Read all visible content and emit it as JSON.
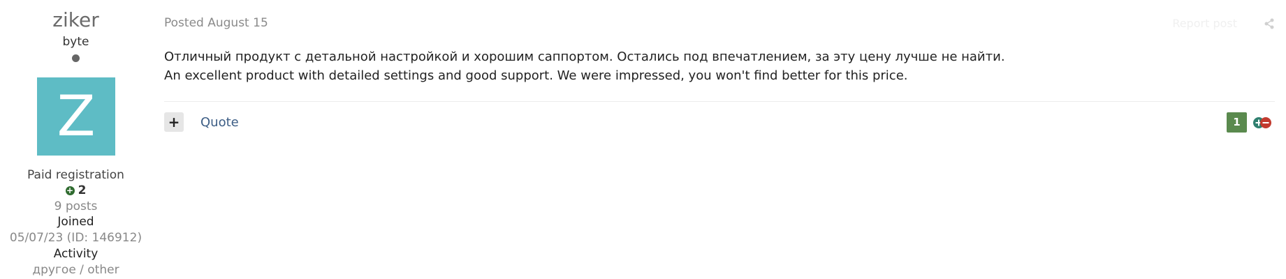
{
  "author": {
    "name": "ziker",
    "rank": "byte",
    "avatar_letter": "Z",
    "avatar_color": "#5ebcc5",
    "group": "Paid registration",
    "reputation": "2",
    "posts": "9 posts",
    "joined_label": "Joined",
    "joined_value": "05/07/23 (ID: 146912)",
    "activity_label": "Activity",
    "activity_value": "другое / other"
  },
  "post": {
    "posted_prefix": "Posted",
    "date": "August 15",
    "report_label": "Report post",
    "content": [
      "Отличный продукт с детальной настройкой и хорошим саппортом. Остались под впечатлением, за эту цену лучше не найти.",
      "An excellent product with detailed settings and good support. We were impressed, you won't find better for this price."
    ],
    "multiquote_icon": "plus-icon",
    "quote_label": "Quote",
    "reaction_count": "1"
  },
  "colors": {
    "link": "#3c5d85",
    "reputation_badge": "#5a8a4e"
  }
}
